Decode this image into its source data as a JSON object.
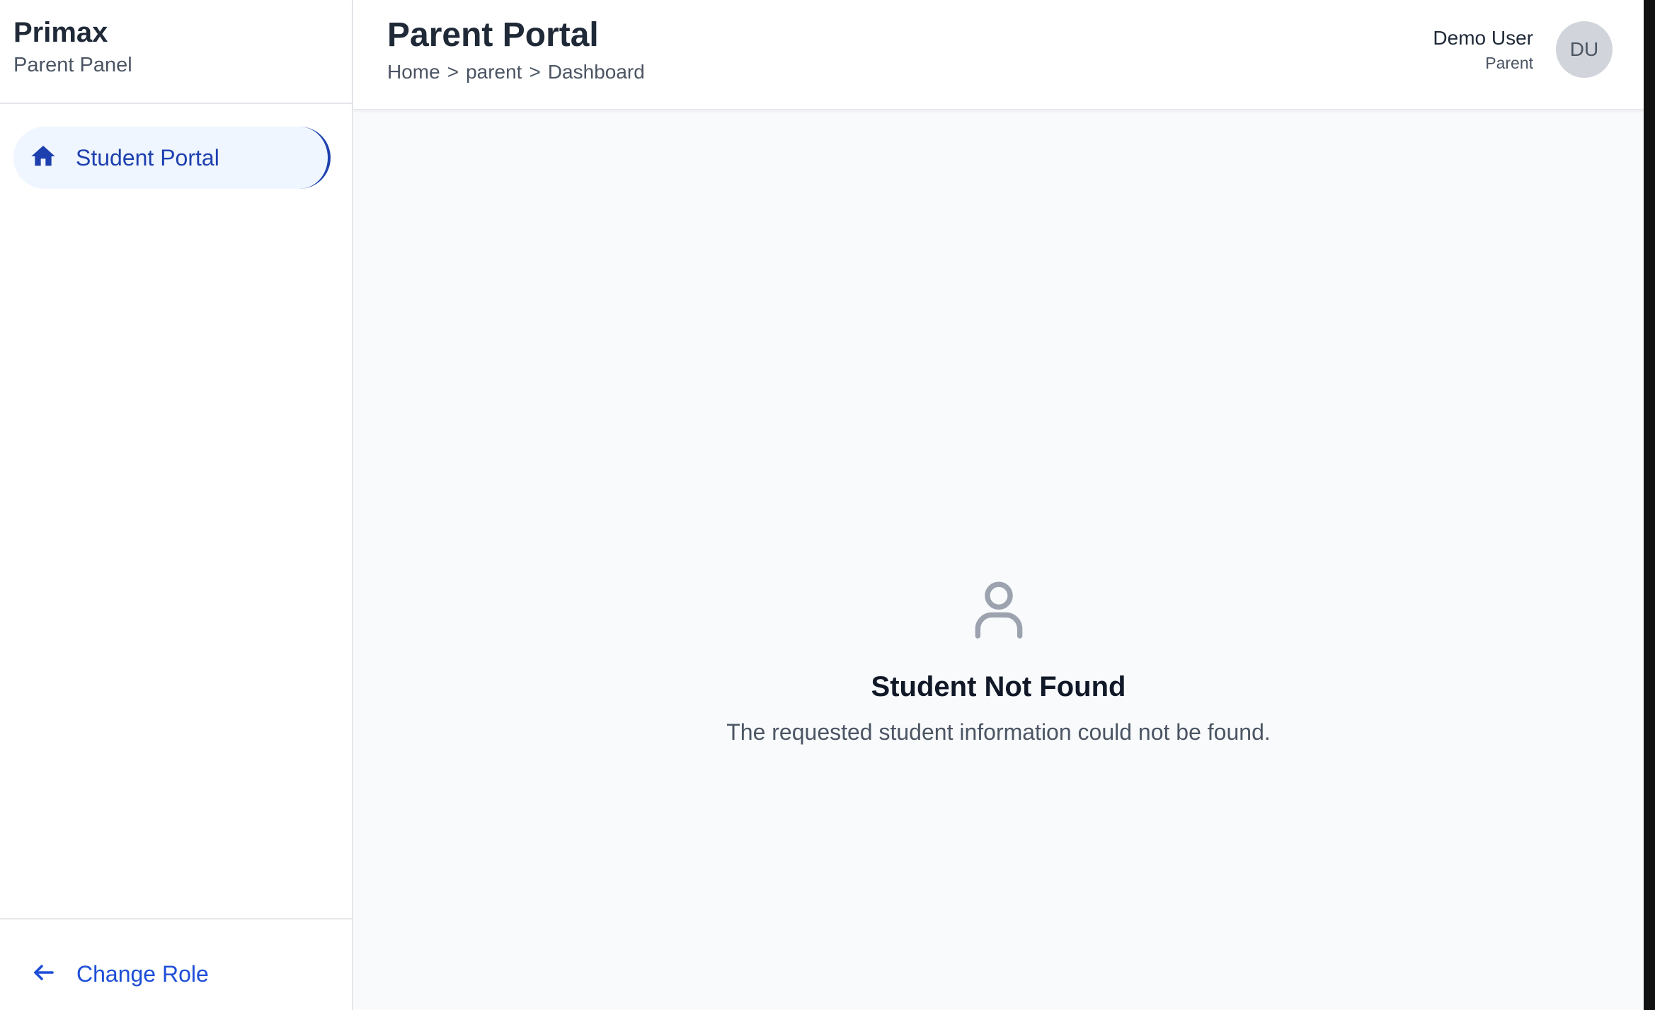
{
  "sidebar": {
    "brand_name": "Primax",
    "brand_sub": "Parent Panel",
    "items": [
      {
        "label": "Student Portal",
        "icon": "home-icon",
        "active": true
      }
    ],
    "footer": {
      "label": "Change Role",
      "icon": "arrow-left-icon"
    }
  },
  "header": {
    "title": "Parent Portal",
    "breadcrumb": [
      "Home",
      "parent",
      "Dashboard"
    ],
    "separator": ">",
    "user": {
      "name": "Demo User",
      "role": "Parent",
      "initials": "DU"
    }
  },
  "empty_state": {
    "icon": "user-icon",
    "title": "Student Not Found",
    "message": "The requested student information could not be found."
  },
  "colors": {
    "accent": "#1e40af",
    "active_bg": "#eff6ff",
    "main_bg": "#f8fafc",
    "avatar_bg": "#d1d5db"
  }
}
